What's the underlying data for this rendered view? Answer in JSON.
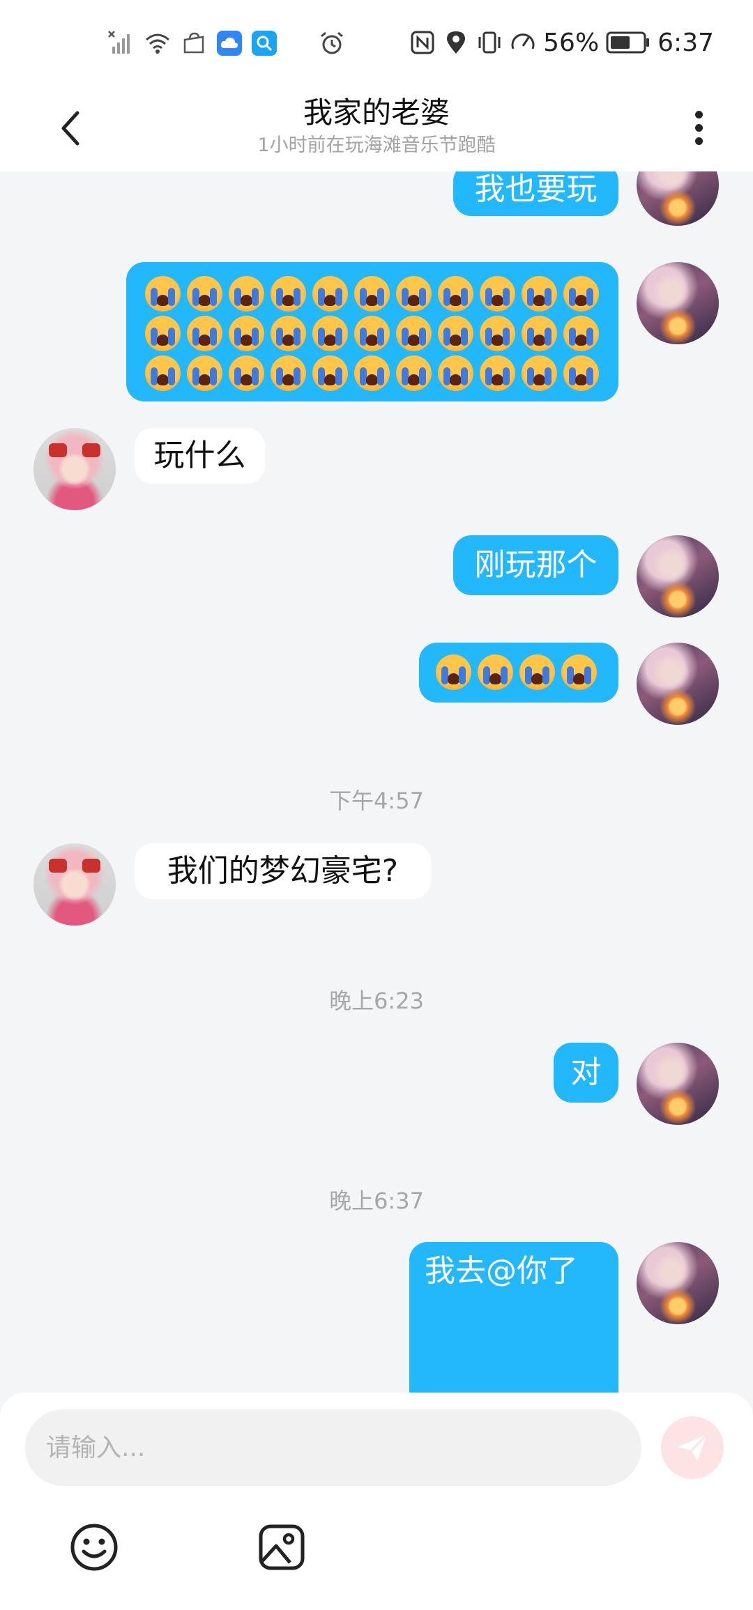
{
  "status_bar": {
    "battery_percent": "56%",
    "time": "6:37",
    "icons": [
      "signal-off-icon",
      "wifi-icon",
      "bag-icon",
      "cloud-app-icon",
      "search-app-icon",
      "alarm-icon",
      "nfc-icon",
      "location-icon",
      "vibrate-icon",
      "speed-icon",
      "battery-icon"
    ]
  },
  "header": {
    "title": "我家的老婆",
    "subtitle": "1小时前在玩海滩音乐节跑酷"
  },
  "messages": [
    {
      "side": "me",
      "text": "我也要玩"
    },
    {
      "side": "me",
      "emoji": "loudly-crying-face",
      "count": 33
    },
    {
      "side": "her",
      "text": "玩什么"
    },
    {
      "side": "me",
      "text": "刚玩那个"
    },
    {
      "side": "me",
      "emoji": "loudly-crying-face",
      "count": 4
    },
    {
      "timestamp": "下午4:57"
    },
    {
      "side": "her",
      "text": "我们的梦幻豪宅?"
    },
    {
      "timestamp": "晚上6:23"
    },
    {
      "side": "me",
      "text": "对"
    },
    {
      "timestamp": "晚上6:37"
    },
    {
      "side": "me",
      "text": "我去@你了"
    }
  ],
  "input": {
    "placeholder": "请输入..."
  },
  "colors": {
    "my_bubble": "#23b7fb",
    "her_bubble": "#ffffff",
    "background": "#f4f5f7",
    "send_button": "#fde3e3"
  },
  "toolbar_icons": [
    "emoji-icon",
    "image-icon"
  ]
}
